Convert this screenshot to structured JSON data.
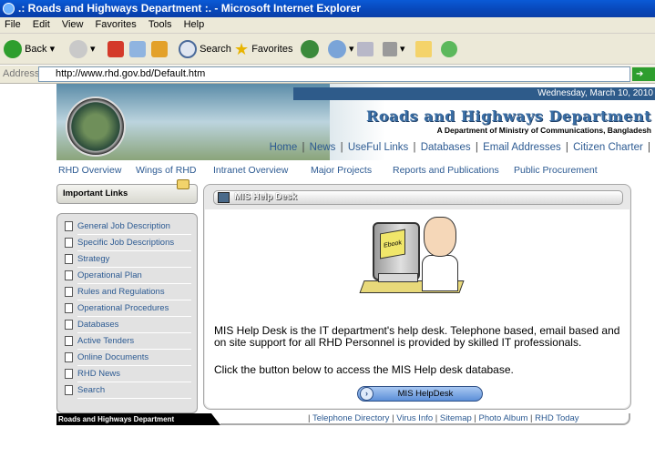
{
  "window": {
    "title": ".: Roads and Highways Department :. - Microsoft Internet Explorer"
  },
  "menubar": [
    "File",
    "Edit",
    "View",
    "Favorites",
    "Tools",
    "Help"
  ],
  "toolbar": {
    "back": "Back",
    "search": "Search",
    "favorites": "Favorites"
  },
  "address": {
    "label": "Address",
    "url": "http://www.rhd.gov.bd/Default.htm",
    "go": "Go"
  },
  "banner": {
    "date": "Wednesday, March 10, 2010",
    "org": "Roads and Highways Department",
    "subtitle": "A Department of Ministry of Communications, Bangladesh",
    "links": [
      "Home",
      "News",
      "UseFul Links",
      "Databases",
      "Email Addresses",
      "Citizen Charter"
    ]
  },
  "nav": [
    "RHD Overview",
    "Wings of RHD",
    "Intranet Overview",
    "Major Projects",
    "Reports and Publications",
    "Public Procurement"
  ],
  "sidebar": {
    "title": "Important Links",
    "items": [
      "General Job Description",
      "Specific Job Descriptions",
      "Strategy",
      "Operational Plan",
      "Rules and Regulations",
      "Operational Procedures",
      "Databases",
      "Active Tenders",
      "Online Documents",
      "RHD News",
      "Search"
    ]
  },
  "main": {
    "heading": "MIS Help Desk",
    "screen_text": "Ebook",
    "para1": "MIS Help Desk is the IT department's help desk. Telephone based, email based and on site support for all RHD Personnel is provided by skilled IT professionals.",
    "para2": "Click the button below to access the MIS Help desk database.",
    "button": "MIS HelpDesk"
  },
  "footer": {
    "org": "Roads and Highways Department",
    "links": [
      "Telephone Directory",
      "Virus Info",
      "Sitemap",
      "Photo Album",
      "RHD Today"
    ]
  }
}
